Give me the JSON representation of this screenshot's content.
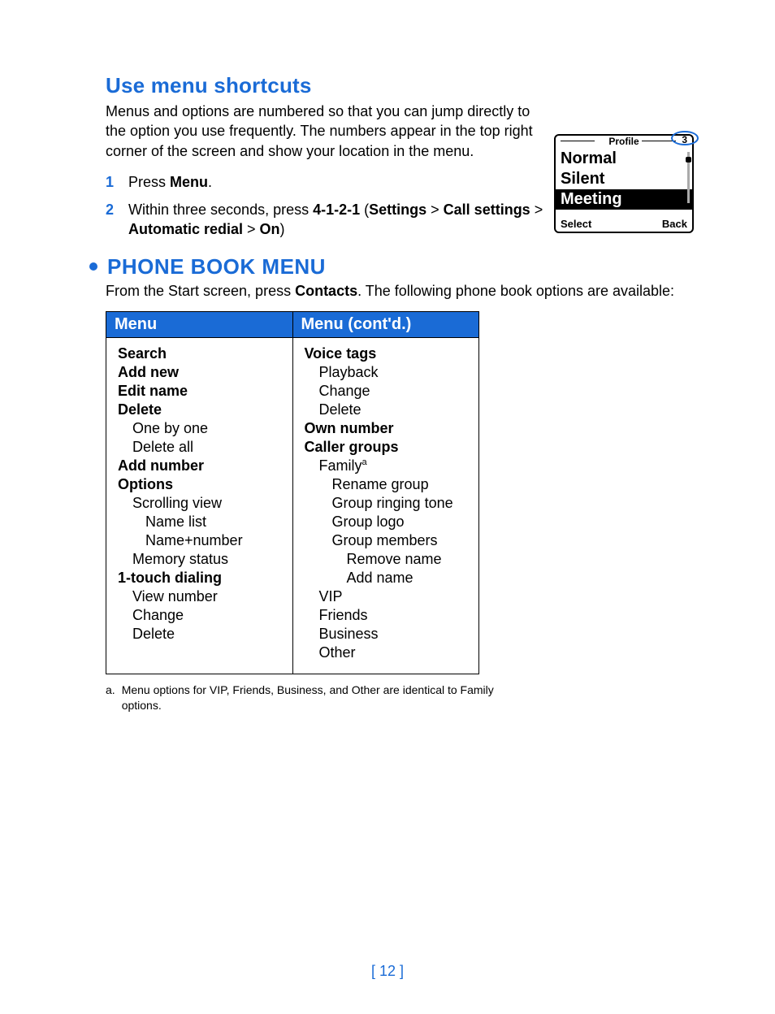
{
  "shortcuts": {
    "heading": "Use menu shortcuts",
    "intro": "Menus and options are numbered so that you can jump directly to the option you use frequently. The numbers appear in the top right corner of the screen and show your location in the menu.",
    "steps": [
      {
        "n": "1",
        "pre": "Press ",
        "bold1": "Menu",
        "post": "."
      },
      {
        "n": "2",
        "pre": "Within three seconds, press ",
        "bold1": "4-1-2-1",
        "mid1": " (",
        "bold2": "Settings",
        "mid2": " > ",
        "bold3": "Call settings",
        "mid3": " > ",
        "bold4": "Automatic redial",
        "mid4": " > ",
        "bold5": "On",
        "post": ")"
      }
    ]
  },
  "phone": {
    "title": "Profile",
    "number": "3",
    "options": [
      "Normal",
      "Silent",
      "Meeting"
    ],
    "selected_index": 2,
    "soft_left": "Select",
    "soft_right": "Back"
  },
  "book": {
    "heading": "PHONE BOOK MENU",
    "intro_pre": "From the Start screen, press ",
    "intro_bold": "Contacts",
    "intro_post": ". The following phone book options are available:"
  },
  "table": {
    "head_left": "Menu",
    "head_right": "Menu (cont'd.)",
    "left": [
      {
        "t": "Search",
        "b": true,
        "i": 0
      },
      {
        "t": "Add new",
        "b": true,
        "i": 0
      },
      {
        "t": "Edit name",
        "b": true,
        "i": 0
      },
      {
        "t": "Delete",
        "b": true,
        "i": 0
      },
      {
        "t": "One by one",
        "b": false,
        "i": 1
      },
      {
        "t": "Delete all",
        "b": false,
        "i": 1
      },
      {
        "t": "Add number",
        "b": true,
        "i": 0
      },
      {
        "t": "Options",
        "b": true,
        "i": 0
      },
      {
        "t": "Scrolling view",
        "b": false,
        "i": 1
      },
      {
        "t": "Name list",
        "b": false,
        "i": 2
      },
      {
        "t": "Name+number",
        "b": false,
        "i": 2
      },
      {
        "t": "Memory status",
        "b": false,
        "i": 1
      },
      {
        "t": "1-touch dialing",
        "b": true,
        "i": 0
      },
      {
        "t": "View number",
        "b": false,
        "i": 1
      },
      {
        "t": "Change",
        "b": false,
        "i": 1
      },
      {
        "t": "Delete",
        "b": false,
        "i": 1
      }
    ],
    "right": [
      {
        "t": "Voice tags",
        "b": true,
        "i": 0
      },
      {
        "t": "Playback",
        "b": false,
        "i": 1
      },
      {
        "t": "Change",
        "b": false,
        "i": 1
      },
      {
        "t": "Delete",
        "b": false,
        "i": 1
      },
      {
        "t": "Own number",
        "b": true,
        "i": 0
      },
      {
        "t": "Caller groups",
        "b": true,
        "i": 0
      },
      {
        "t": "Family",
        "b": false,
        "i": 1,
        "sup": "a"
      },
      {
        "t": "Rename group",
        "b": false,
        "i": 2
      },
      {
        "t": "Group ringing tone",
        "b": false,
        "i": 2
      },
      {
        "t": "Group logo",
        "b": false,
        "i": 2
      },
      {
        "t": "Group members",
        "b": false,
        "i": 2
      },
      {
        "t": "Remove name",
        "b": false,
        "i": 3
      },
      {
        "t": "Add name",
        "b": false,
        "i": 3
      },
      {
        "t": "VIP",
        "b": false,
        "i": 1
      },
      {
        "t": "Friends",
        "b": false,
        "i": 1
      },
      {
        "t": "Business",
        "b": false,
        "i": 1
      },
      {
        "t": "Other",
        "b": false,
        "i": 1
      }
    ]
  },
  "footnote": {
    "key": "a.",
    "text": "Menu options for VIP, Friends, Business, and Other are identical to Family options."
  },
  "page_number": "[ 12 ]"
}
